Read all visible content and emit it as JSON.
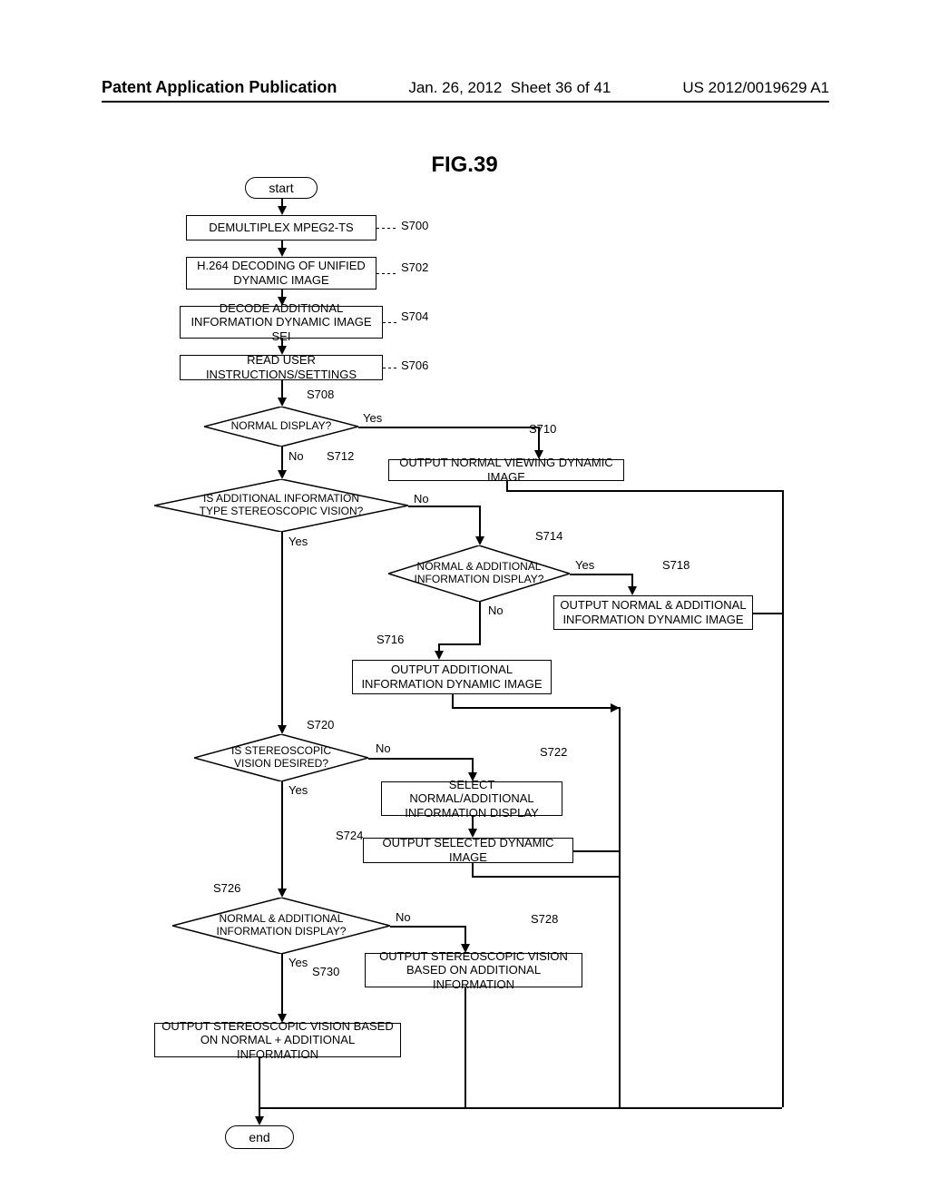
{
  "header": {
    "left": "Patent Application Publication",
    "date": "Jan. 26, 2012",
    "sheet": "Sheet 36 of 41",
    "pubno": "US 2012/0019629 A1"
  },
  "figure_title": "FIG.39",
  "chart_data": {
    "type": "flowchart",
    "nodes": [
      {
        "id": "start",
        "kind": "terminator",
        "text": "start"
      },
      {
        "id": "S700",
        "kind": "process",
        "label": "S700",
        "text": "DEMULTIPLEX MPEG2-TS"
      },
      {
        "id": "S702",
        "kind": "process",
        "label": "S702",
        "text": "H.264 DECODING OF UNIFIED DYNAMIC IMAGE"
      },
      {
        "id": "S704",
        "kind": "process",
        "label": "S704",
        "text": "DECODE ADDITIONAL INFORMATION DYNAMIC IMAGE SEI"
      },
      {
        "id": "S706",
        "kind": "process",
        "label": "S706",
        "text": "READ USER INSTRUCTIONS/SETTINGS"
      },
      {
        "id": "S708",
        "kind": "decision",
        "label": "S708",
        "text": "NORMAL DISPLAY?"
      },
      {
        "id": "S710",
        "kind": "process",
        "label": "S710",
        "text": "OUTPUT NORMAL VIEWING DYNAMIC IMAGE"
      },
      {
        "id": "S712",
        "kind": "decision",
        "label": "S712",
        "text": "IS ADDITIONAL INFORMATION TYPE STEREOSCOPIC VISION?"
      },
      {
        "id": "S714",
        "kind": "decision",
        "label": "S714",
        "text": "NORMAL & ADDITIONAL INFORMATION DISPLAY?"
      },
      {
        "id": "S716",
        "kind": "process",
        "label": "S716",
        "text": "OUTPUT ADDITIONAL INFORMATION DYNAMIC IMAGE"
      },
      {
        "id": "S718",
        "kind": "process",
        "label": "S718",
        "text": "OUTPUT NORMAL & ADDITIONAL INFORMATION DYNAMIC IMAGE"
      },
      {
        "id": "S720",
        "kind": "decision",
        "label": "S720",
        "text": "IS STEREOSCOPIC VISION DESIRED?"
      },
      {
        "id": "S722",
        "kind": "process",
        "label": "S722",
        "text": "SELECT NORMAL/ADDITIONAL INFORMATION DISPLAY"
      },
      {
        "id": "S724",
        "kind": "process",
        "label": "S724",
        "text": "OUTPUT SELECTED DYNAMIC IMAGE"
      },
      {
        "id": "S726",
        "kind": "decision",
        "label": "S726",
        "text": "NORMAL & ADDITIONAL INFORMATION DISPLAY?"
      },
      {
        "id": "S728",
        "kind": "process",
        "label": "S728",
        "text": "OUTPUT STEREOSCOPIC VISION BASED ON ADDITIONAL INFORMATION"
      },
      {
        "id": "S730",
        "kind": "process",
        "label": "S730",
        "text": "OUTPUT STEREOSCOPIC VISION BASED ON NORMAL + ADDITIONAL INFORMATION"
      },
      {
        "id": "end",
        "kind": "terminator",
        "text": "end"
      }
    ],
    "edges": [
      {
        "from": "start",
        "to": "S700"
      },
      {
        "from": "S700",
        "to": "S702"
      },
      {
        "from": "S702",
        "to": "S704"
      },
      {
        "from": "S704",
        "to": "S706"
      },
      {
        "from": "S706",
        "to": "S708"
      },
      {
        "from": "S708",
        "to": "S710",
        "label": "Yes"
      },
      {
        "from": "S708",
        "to": "S712",
        "label": "No"
      },
      {
        "from": "S710",
        "to": "end"
      },
      {
        "from": "S712",
        "to": "S720",
        "label": "Yes"
      },
      {
        "from": "S712",
        "to": "S714",
        "label": "No"
      },
      {
        "from": "S714",
        "to": "S718",
        "label": "Yes"
      },
      {
        "from": "S714",
        "to": "S716",
        "label": "No"
      },
      {
        "from": "S716",
        "to": "end"
      },
      {
        "from": "S718",
        "to": "end"
      },
      {
        "from": "S720",
        "to": "S726",
        "label": "Yes"
      },
      {
        "from": "S720",
        "to": "S722",
        "label": "No"
      },
      {
        "from": "S722",
        "to": "S724"
      },
      {
        "from": "S724",
        "to": "end"
      },
      {
        "from": "S726",
        "to": "S730",
        "label": "Yes"
      },
      {
        "from": "S726",
        "to": "S728",
        "label": "No"
      },
      {
        "from": "S728",
        "to": "end"
      },
      {
        "from": "S730",
        "to": "end"
      }
    ]
  },
  "labels": {
    "yes": "Yes",
    "no": "No"
  }
}
